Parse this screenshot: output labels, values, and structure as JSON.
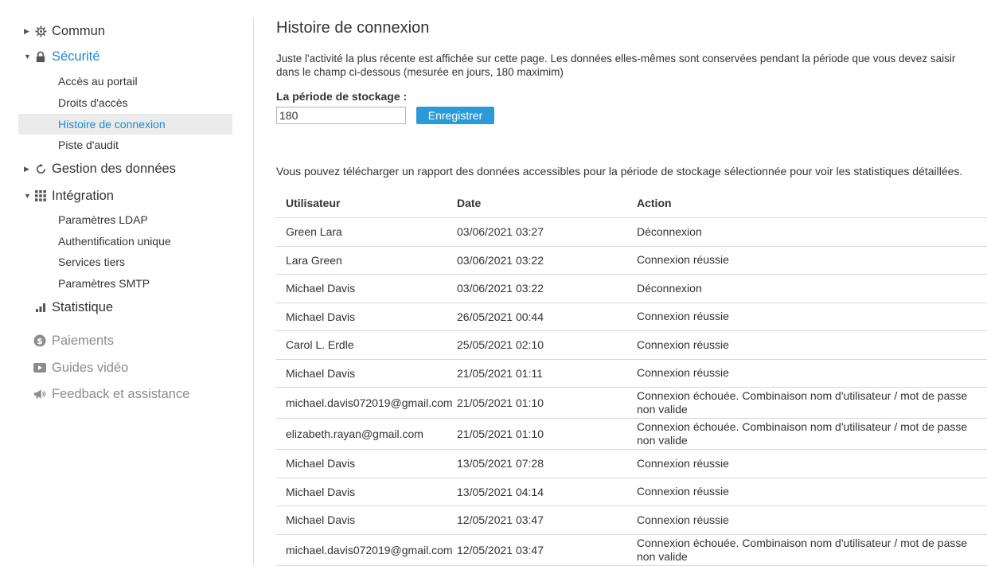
{
  "sidebar": {
    "groups": [
      {
        "label": "Commun",
        "icon": "gear-icon",
        "expanded": false
      },
      {
        "label": "Sécurité",
        "icon": "lock-icon",
        "expanded": true,
        "items": [
          "Accès au portail",
          "Droits d'accès",
          "Histoire de connexion",
          "Piste d'audit"
        ],
        "selected": "Histoire de connexion"
      },
      {
        "label": "Gestion des données",
        "icon": "refresh-icon",
        "expanded": false
      },
      {
        "label": "Intégration",
        "icon": "grid-icon",
        "expanded": true,
        "items": [
          "Paramètres LDAP",
          "Authentification unique",
          "Services tiers",
          "Paramètres SMTP"
        ]
      },
      {
        "label": "Statistique",
        "icon": "bar-chart-icon"
      }
    ],
    "extras": [
      {
        "label": "Paiements",
        "icon": "dollar-circle-icon"
      },
      {
        "label": "Guides vidéo",
        "icon": "video-play-icon"
      },
      {
        "label": "Feedback et assistance",
        "icon": "megaphone-icon"
      }
    ]
  },
  "main": {
    "title": "Histoire de connexion",
    "description": "Juste l'activité la plus récente est affichée sur cette page. Les données elles-mêmes sont conservées pendant la période que vous devez saisir dans le champ ci-dessous (mesurée en jours, 180 maximim)",
    "storage_label": "La période de stockage :",
    "storage_value": "180",
    "save_label": "Enregistrer",
    "report_text": "Vous pouvez télécharger un rapport des données accessibles pour la période de stockage sélectionnée pour voir les statistiques détaillées.",
    "table": {
      "headers": [
        "Utilisateur",
        "Date",
        "Action"
      ],
      "rows": [
        [
          "Green Lara",
          "03/06/2021 03:27",
          "Déconnexion"
        ],
        [
          "Lara Green",
          "03/06/2021 03:22",
          "Connexion réussie"
        ],
        [
          "Michael Davis",
          "03/06/2021 03:22",
          "Déconnexion"
        ],
        [
          "Michael Davis",
          "26/05/2021 00:44",
          "Connexion réussie"
        ],
        [
          "Carol L. Erdle",
          "25/05/2021 02:10",
          "Connexion réussie"
        ],
        [
          "Michael Davis",
          "21/05/2021 01:11",
          "Connexion réussie"
        ],
        [
          "michael.davis072019@gmail.com",
          "21/05/2021 01:10",
          "Connexion échouée. Combinaison nom d'utilisateur / mot de passe non valide"
        ],
        [
          "elizabeth.rayan@gmail.com",
          "21/05/2021 01:10",
          "Connexion échouée. Combinaison nom d'utilisateur / mot de passe non valide"
        ],
        [
          "Michael Davis",
          "13/05/2021 07:28",
          "Connexion réussie"
        ],
        [
          "Michael Davis",
          "13/05/2021 04:14",
          "Connexion réussie"
        ],
        [
          "Michael Davis",
          "12/05/2021 03:47",
          "Connexion réussie"
        ],
        [
          "michael.davis072019@gmail.com",
          "12/05/2021 03:47",
          "Connexion échouée. Combinaison nom d'utilisateur / mot de passe non valide"
        ]
      ]
    }
  },
  "colors": {
    "accent": "#1a8ad4",
    "button": "#2b9ad8",
    "selected_bg": "#ebebeb",
    "muted": "#8c8c8c"
  }
}
